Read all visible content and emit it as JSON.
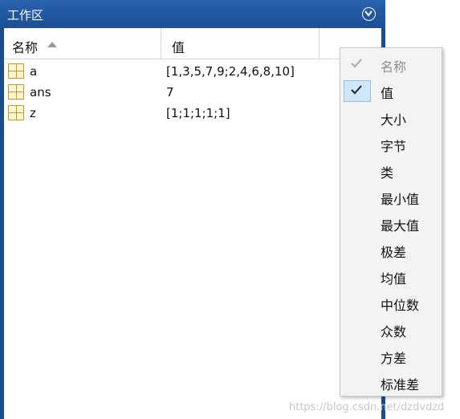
{
  "panel": {
    "title": "工作区",
    "menu_icon": "chevron-down-circle-icon",
    "columns": {
      "name": "名称",
      "value": "值"
    },
    "variables": [
      {
        "name": "a",
        "value": "[1,3,5,7,9;2,4,6,8,10]"
      },
      {
        "name": "ans",
        "value": "7"
      },
      {
        "name": "z",
        "value": "[1;1;1;1;1]"
      }
    ]
  },
  "menu": {
    "items": [
      {
        "label": "名称",
        "checked": true,
        "disabled": true
      },
      {
        "label": "值",
        "checked": true,
        "disabled": false
      },
      {
        "label": "大小"
      },
      {
        "label": "字节"
      },
      {
        "label": "类"
      },
      {
        "label": "最小值"
      },
      {
        "label": "最大值"
      },
      {
        "label": "极差"
      },
      {
        "label": "均值"
      },
      {
        "label": "中位数"
      },
      {
        "label": "众数"
      },
      {
        "label": "方差"
      },
      {
        "label": "标准差"
      }
    ]
  },
  "watermark": "https://blog.csdn.net/dzdvdzd",
  "colors": {
    "titlebar": "#1c4c8c",
    "check_highlight": "#cfe6fb",
    "var_icon": "#c19a2f"
  }
}
